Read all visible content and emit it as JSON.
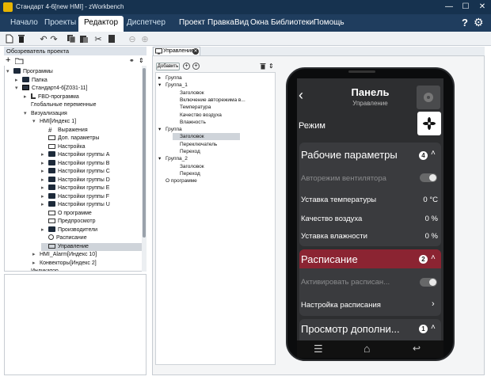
{
  "window": {
    "title": "Стандарт 4-6[new HMI] - zWorkbench",
    "minimize": "—",
    "maximize": "☐",
    "close": "✕"
  },
  "menu": {
    "tabs": [
      "Начало",
      "Проекты",
      "Редактор",
      "Диспетчер"
    ],
    "active_tab": "Редактор",
    "items": [
      "Проект",
      "Правка",
      "Вид",
      "Окна",
      "Библиотеки",
      "Помощь"
    ],
    "help_glyph": "?",
    "settings_glyph": "⚙"
  },
  "left_panel": {
    "header": "Обозреватель проекта",
    "tree": [
      {
        "label": "Программы",
        "indent": 0,
        "arrow": "▾",
        "icon": "folder"
      },
      {
        "label": "Папка",
        "indent": 1,
        "arrow": "▸",
        "icon": "folder"
      },
      {
        "label": "Стандарт4-6[Z031-11]",
        "indent": 1,
        "arrow": "▾",
        "icon": "device"
      },
      {
        "label": "FBD-программа",
        "indent": 2,
        "arrow": "▸",
        "icon": "fbd"
      },
      {
        "label": "Глобальные переменные",
        "indent": 2,
        "arrow": "",
        "icon": ""
      },
      {
        "label": "Визуализация",
        "indent": 2,
        "arrow": "▾",
        "icon": ""
      },
      {
        "label": "HMI[Индекс 1]",
        "indent": 3,
        "arrow": "▾",
        "icon": ""
      },
      {
        "label": "Выражения",
        "indent": 4,
        "arrow": "",
        "icon": "hash"
      },
      {
        "label": "Доп. параметры",
        "indent": 4,
        "arrow": "",
        "icon": "monitor"
      },
      {
        "label": "Настройка",
        "indent": 4,
        "arrow": "",
        "icon": "monitor"
      },
      {
        "label": "Настройки группы A",
        "indent": 4,
        "arrow": "▸",
        "icon": "folder"
      },
      {
        "label": "Настройки группы B",
        "indent": 4,
        "arrow": "▸",
        "icon": "folder"
      },
      {
        "label": "Настройки группы C",
        "indent": 4,
        "arrow": "▸",
        "icon": "folder"
      },
      {
        "label": "Настройки группы D",
        "indent": 4,
        "arrow": "▸",
        "icon": "folder"
      },
      {
        "label": "Настройки группы E",
        "indent": 4,
        "arrow": "▸",
        "icon": "folder"
      },
      {
        "label": "Настройки группы F",
        "indent": 4,
        "arrow": "▸",
        "icon": "folder"
      },
      {
        "label": "Настройки группы U",
        "indent": 4,
        "arrow": "▸",
        "icon": "folder"
      },
      {
        "label": "О программе",
        "indent": 4,
        "arrow": "",
        "icon": "monitor"
      },
      {
        "label": "Предпросмотр",
        "indent": 4,
        "arrow": "",
        "icon": "monitor"
      },
      {
        "label": "Производители",
        "indent": 4,
        "arrow": "▸",
        "icon": "folder"
      },
      {
        "label": "Расписание",
        "indent": 4,
        "arrow": "",
        "icon": "clock"
      },
      {
        "label": "Управление",
        "indent": 4,
        "arrow": "",
        "icon": "monitor",
        "selected": true
      },
      {
        "label": "HMI_Alarm[Индекс 10]",
        "indent": 3,
        "arrow": "▸",
        "icon": ""
      },
      {
        "label": "Конвекторы[Индекс 2]",
        "indent": 3,
        "arrow": "▸",
        "icon": ""
      },
      {
        "label": "Индикатор",
        "indent": 2,
        "arrow": "",
        "icon": ""
      }
    ]
  },
  "editor": {
    "tab_label": "Управление",
    "add_button": "Добавить",
    "screen_list": [
      {
        "label": "Группа",
        "indent": 0,
        "arrow": "▸"
      },
      {
        "label": "Группа_1",
        "indent": 0,
        "arrow": "▾"
      },
      {
        "label": "Заголовок",
        "indent": 1,
        "arrow": ""
      },
      {
        "label": "Включение авторежима в...",
        "indent": 1,
        "arrow": ""
      },
      {
        "label": "Температура",
        "indent": 1,
        "arrow": ""
      },
      {
        "label": "Качество воздуха",
        "indent": 1,
        "arrow": ""
      },
      {
        "label": "Влажность",
        "indent": 1,
        "arrow": ""
      },
      {
        "label": "Группа",
        "indent": 0,
        "arrow": "▾"
      },
      {
        "label": "Заголовок",
        "indent": 1,
        "arrow": "",
        "selected": true
      },
      {
        "label": "Переключатель",
        "indent": 1,
        "arrow": ""
      },
      {
        "label": "Переход",
        "indent": 1,
        "arrow": ""
      },
      {
        "label": "Группа_2",
        "indent": 0,
        "arrow": "▾"
      },
      {
        "label": "Заголовок",
        "indent": 1,
        "arrow": ""
      },
      {
        "label": "Переход",
        "indent": 1,
        "arrow": ""
      },
      {
        "label": "О программе",
        "indent": 0,
        "arrow": ""
      }
    ]
  },
  "phone": {
    "back_glyph": "‹",
    "title": "Панель",
    "subtitle": "Управление",
    "mode_label": "Режим",
    "card1": {
      "title": "Рабочие параметры",
      "badge": "4",
      "rows": [
        {
          "label": "Авторежим вентилятора",
          "value": "",
          "dim": true
        },
        {
          "label": "Уставка температуры",
          "value": "0 °C"
        },
        {
          "label": "Качество воздуха",
          "value": "0 %"
        },
        {
          "label": "Уставка влажности",
          "value": "0 %"
        }
      ]
    },
    "card2": {
      "title": "Расписание",
      "badge": "2",
      "rows": [
        {
          "label": "Активировать расписан...",
          "dim": true
        },
        {
          "label": "Настройка расписания"
        }
      ]
    },
    "card3": {
      "title": "Просмотр дополни...",
      "badge": "1"
    },
    "nav": {
      "menu": "☰",
      "home": "⌂",
      "back": "↩"
    },
    "colors": {
      "accent": "#8b2432",
      "screen": "#2d2e30",
      "card": "#3a3b3e"
    }
  }
}
